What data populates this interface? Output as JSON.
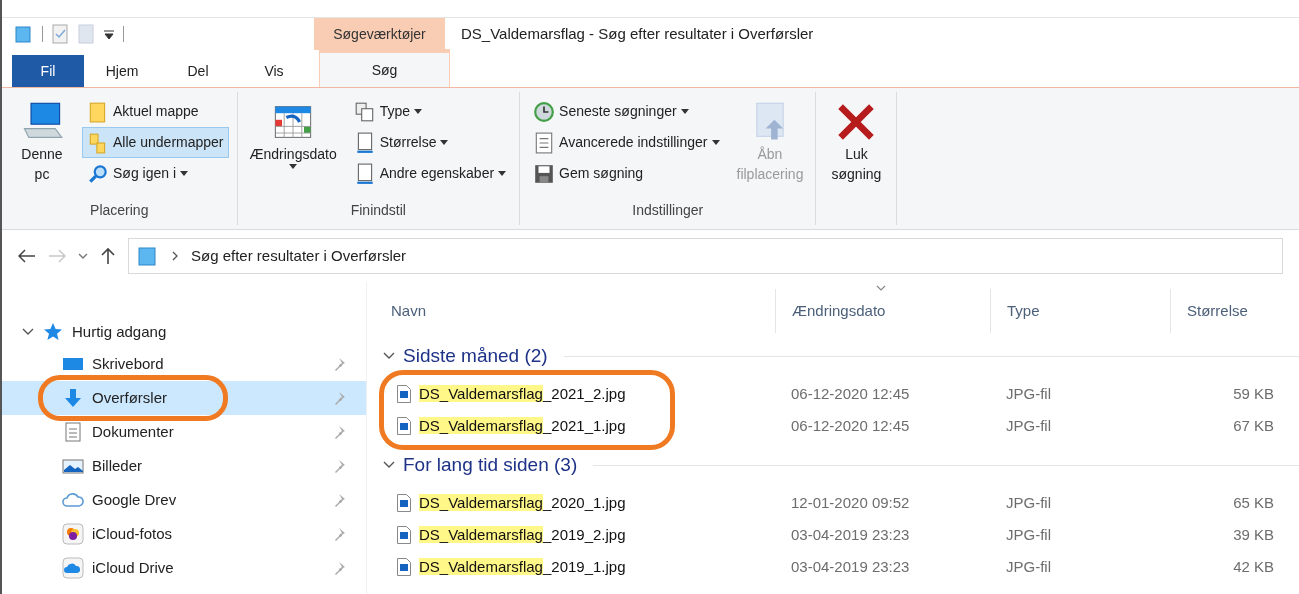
{
  "window": {
    "title": "DS_Valdemarsflag - Søg efter resultater i Overførsler",
    "context_tab_group": "Søgeværktøjer"
  },
  "tabs": [
    {
      "label": "Fil",
      "kind": "file",
      "selected": false
    },
    {
      "label": "Hjem",
      "kind": "tab",
      "selected": false
    },
    {
      "label": "Del",
      "kind": "tab",
      "selected": false
    },
    {
      "label": "Vis",
      "kind": "tab",
      "selected": false
    },
    {
      "label": "Søg",
      "kind": "context",
      "selected": true
    }
  ],
  "ribbon": {
    "groups": [
      {
        "label": "Placering",
        "items": [
          {
            "label": "Denne pc",
            "kind": "large",
            "dropdown": false,
            "disabled": false,
            "selected": false
          },
          {
            "label": "Aktuel mappe",
            "kind": "small",
            "dropdown": false,
            "disabled": false,
            "selected": false
          },
          {
            "label": "Alle undermapper",
            "kind": "small",
            "dropdown": false,
            "disabled": false,
            "selected": true
          },
          {
            "label": "Søg igen i",
            "kind": "small",
            "dropdown": true,
            "disabled": false,
            "selected": false
          }
        ]
      },
      {
        "label": "Finindstil",
        "items": [
          {
            "label": "Ændringsdato",
            "kind": "large",
            "dropdown": true,
            "disabled": false,
            "selected": false
          },
          {
            "label": "Type",
            "kind": "small",
            "dropdown": true,
            "disabled": false,
            "selected": false
          },
          {
            "label": "Størrelse",
            "kind": "small",
            "dropdown": true,
            "disabled": false,
            "selected": false
          },
          {
            "label": "Andre egenskaber",
            "kind": "small",
            "dropdown": true,
            "disabled": false,
            "selected": false
          }
        ]
      },
      {
        "label": "Indstillinger",
        "items": [
          {
            "label": "Seneste søgninger",
            "kind": "small",
            "dropdown": true,
            "disabled": false,
            "selected": false
          },
          {
            "label": "Avancerede indstillinger",
            "kind": "small",
            "dropdown": true,
            "disabled": false,
            "selected": false
          },
          {
            "label": "Gem søgning",
            "kind": "small",
            "dropdown": false,
            "disabled": false,
            "selected": false
          },
          {
            "label": "Åbn filplacering",
            "kind": "large",
            "dropdown": false,
            "disabled": true,
            "selected": false
          }
        ]
      },
      {
        "items": [
          {
            "label": "Luk søgning",
            "kind": "large",
            "dropdown": false,
            "disabled": false,
            "selected": false
          }
        ]
      }
    ]
  },
  "nav": {
    "forward_disabled": true,
    "address": "Søg efter resultater i Overførsler"
  },
  "sidebar": {
    "items": [
      {
        "label": "Hurtig adgang",
        "expanded": true,
        "children": [
          {
            "label": "Skrivebord",
            "pinned": true,
            "selected": false,
            "circled": false
          },
          {
            "label": "Overførsler",
            "pinned": true,
            "selected": true,
            "circled": true
          },
          {
            "label": "Dokumenter",
            "pinned": true,
            "selected": false,
            "circled": false
          },
          {
            "label": "Billeder",
            "pinned": true,
            "selected": false,
            "circled": false
          },
          {
            "label": "Google Drev",
            "pinned": true,
            "selected": false,
            "circled": false
          },
          {
            "label": "iCloud-fotos",
            "pinned": true,
            "selected": false,
            "circled": false
          },
          {
            "label": "iCloud Drive",
            "pinned": true,
            "selected": false,
            "circled": false
          }
        ]
      }
    ]
  },
  "table": {
    "columns": [
      {
        "label": "Navn",
        "sorted": false
      },
      {
        "label": "Ændringsdato",
        "sorted": true
      },
      {
        "label": "Type",
        "sorted": false
      },
      {
        "label": "Størrelse",
        "sorted": false
      }
    ],
    "groups": [
      {
        "label": "Sidste måned (2)",
        "expanded": true,
        "circled": true,
        "rows": [
          {
            "match": "DS_Valdemarsflag",
            "rest": "_2021_2.jpg",
            "date": "06-12-2020 12:45",
            "type": "JPG-fil",
            "size": "59 KB"
          },
          {
            "match": "DS_Valdemarsflag",
            "rest": "_2021_1.jpg",
            "date": "06-12-2020 12:45",
            "type": "JPG-fil",
            "size": "67 KB"
          }
        ]
      },
      {
        "label": "For lang tid siden (3)",
        "expanded": true,
        "circled": false,
        "rows": [
          {
            "match": "DS_Valdemarsflag",
            "rest": "_2020_1.jpg",
            "date": "12-01-2020 09:52",
            "type": "JPG-fil",
            "size": "65 KB"
          },
          {
            "match": "DS_Valdemarsflag",
            "rest": "_2019_2.jpg",
            "date": "03-04-2019 23:23",
            "type": "JPG-fil",
            "size": "39 KB"
          },
          {
            "match": "DS_Valdemarsflag",
            "rest": "_2019_1.jpg",
            "date": "03-04-2019 23:23",
            "type": "JPG-fil",
            "size": "42 KB"
          }
        ]
      }
    ]
  }
}
